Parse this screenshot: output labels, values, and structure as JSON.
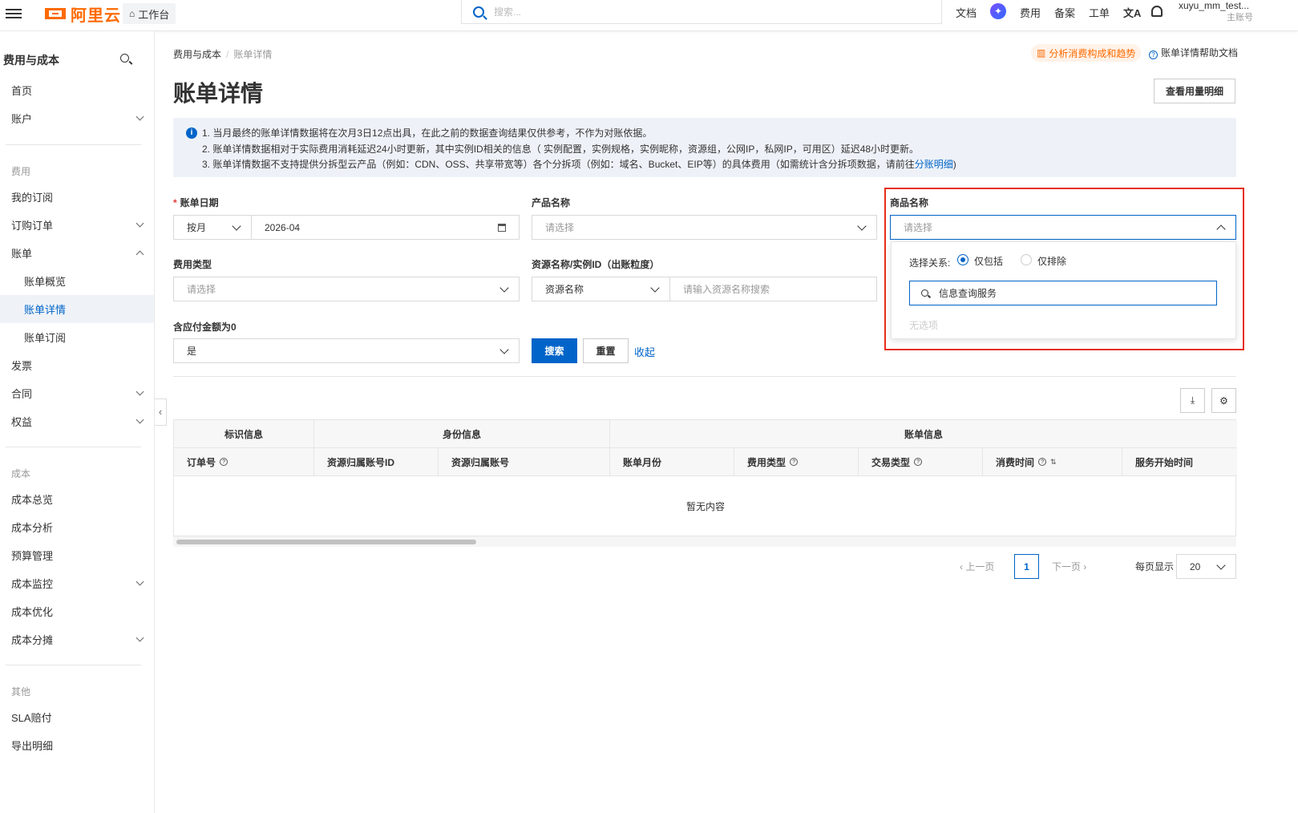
{
  "topbar": {
    "logo": "阿里云",
    "workbench": "工作台",
    "search_placeholder": "搜索...",
    "nav": [
      "文档",
      "费用",
      "备案",
      "工单"
    ],
    "user_name": "xuyu_mm_test...",
    "user_role": "主账号",
    "brand_color": "#ff6a00"
  },
  "sidebar": {
    "title": "费用与成本",
    "items": {
      "home": "首页",
      "account": "账户",
      "sec_cost_fee": "费用",
      "my_sub": "我的订阅",
      "orders": "订购订单",
      "bill": "账单",
      "bill_overview": "账单概览",
      "bill_detail": "账单详情",
      "bill_sub": "账单订阅",
      "invoice": "发票",
      "contract": "合同",
      "rights": "权益",
      "sec_cost": "成本",
      "cost_overview": "成本总览",
      "cost_analysis": "成本分析",
      "budget": "预算管理",
      "cost_monitor": "成本监控",
      "cost_opt": "成本优化",
      "cost_alloc": "成本分摊",
      "sec_other": "其他",
      "sla": "SLA赔付",
      "export": "导出明细"
    }
  },
  "page": {
    "breadcrumb_parent": "费用与成本",
    "breadcrumb_current": "账单详情",
    "title": "账单详情",
    "analyze_link": "分析消费构成和趋势",
    "help_link": "账单详情帮助文档",
    "usage_button": "查看用量明细"
  },
  "notice": {
    "line1": "1. 当月最终的账单详情数据将在次月3日12点出具，在此之前的数据查询结果仅供参考，不作为对账依据。",
    "line2": "2. 账单详情数据相对于实际费用消耗延迟24小时更新，其中实例ID相关的信息（ 实例配置，实例规格，实例昵称，资源组，公网IP，私网IP，可用区）延迟48小时更新。",
    "line3_prefix": "3. 账单详情数据不支持提供分拆型云产品（例如：CDN、OSS、共享带宽等）各个分拆项（例如：域名、Bucket、EIP等）的具体费用（如需统计含分拆项数据，请前往",
    "line3_link": "分账明细",
    "line3_suffix": ")"
  },
  "filters": {
    "bill_date_label": "账单日期",
    "period": "按月",
    "date_value": "2026-04",
    "product_label": "产品名称",
    "product_placeholder": "请选择",
    "commodity_label": "商品名称",
    "commodity_placeholder": "请选择",
    "fee_type_label": "费用类型",
    "fee_type_placeholder": "请选择",
    "resource_label": "资源名称/实例ID（出账粒度）",
    "resource_type": "资源名称",
    "resource_placeholder": "请输入资源名称搜索",
    "zero_label": "含应付金额为0",
    "zero_value": "是",
    "search_btn": "搜索",
    "reset_btn": "重置",
    "collapse_link": "收起"
  },
  "dropdown": {
    "relation_label": "选择关系:",
    "include": "仅包括",
    "exclude": "仅排除",
    "search_value": "信息查询服务",
    "empty": "无选项"
  },
  "table": {
    "groups": [
      "标识信息",
      "身份信息",
      "账单信息"
    ],
    "columns": [
      "订单号",
      "资源归属账号ID",
      "资源归属账号",
      "账单月份",
      "费用类型",
      "交易类型",
      "消费时间",
      "服务开始时间"
    ],
    "empty": "暂无内容"
  },
  "pagination": {
    "prev": "上一页",
    "next": "下一页",
    "current": "1",
    "per_page_label": "每页显示",
    "per_page": "20"
  }
}
